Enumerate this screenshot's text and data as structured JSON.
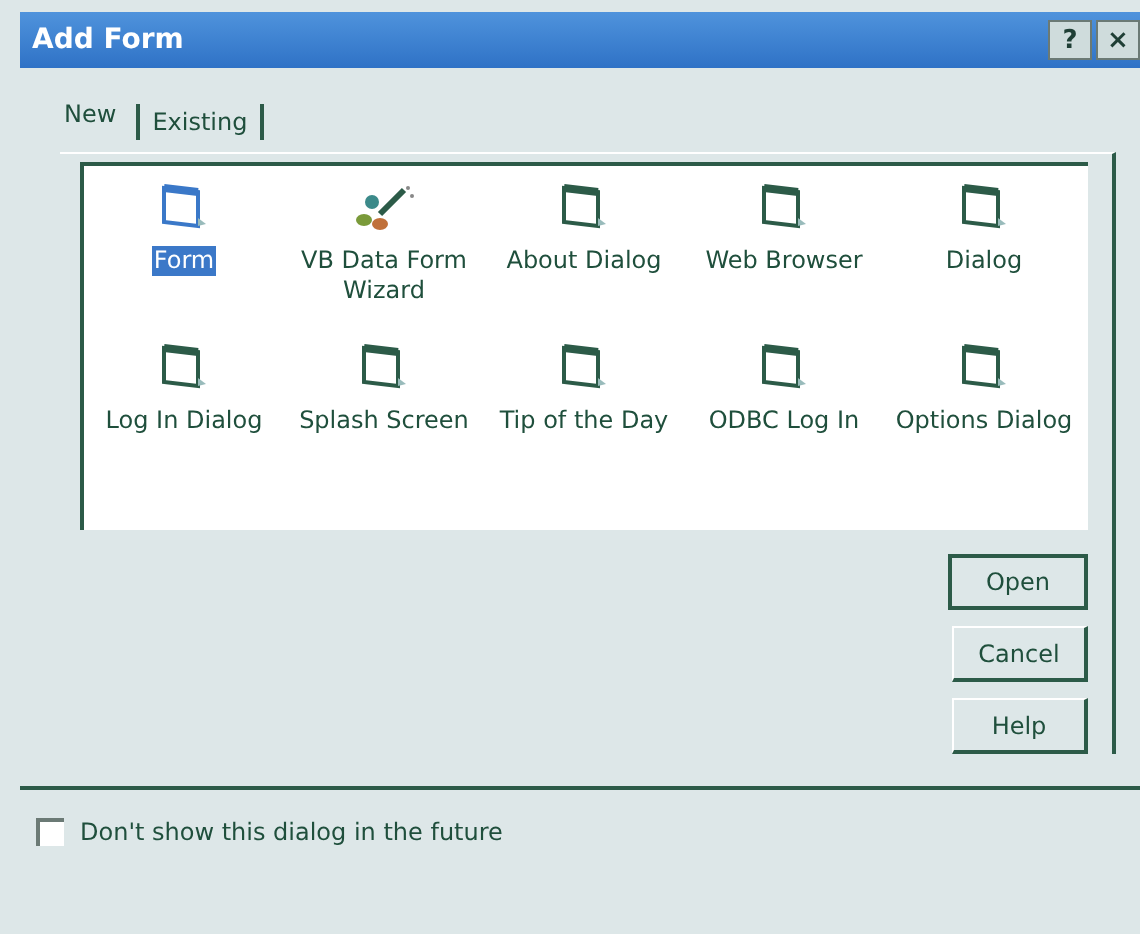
{
  "window": {
    "title": "Add Form",
    "title_buttons": [
      "?",
      "×"
    ]
  },
  "tabs": [
    {
      "label": "New",
      "selected": true
    },
    {
      "label": "Existing",
      "selected": false
    }
  ],
  "templates": [
    {
      "label": "Form",
      "kind": "form",
      "selected": true
    },
    {
      "label": "VB Data Form Wizard",
      "kind": "wizard",
      "selected": false
    },
    {
      "label": "About Dialog",
      "kind": "form",
      "selected": false
    },
    {
      "label": "Web Browser",
      "kind": "form",
      "selected": false
    },
    {
      "label": "Dialog",
      "kind": "form",
      "selected": false
    },
    {
      "label": "Log In Dialog",
      "kind": "form",
      "selected": false
    },
    {
      "label": "Splash Screen",
      "kind": "form",
      "selected": false
    },
    {
      "label": "Tip of the Day",
      "kind": "form",
      "selected": false
    },
    {
      "label": "ODBC Log In",
      "kind": "form",
      "selected": false
    },
    {
      "label": "Options Dialog",
      "kind": "form",
      "selected": false
    }
  ],
  "buttons": [
    {
      "label": "Open",
      "default": true
    },
    {
      "label": "Cancel",
      "default": false
    },
    {
      "label": "Help",
      "default": false
    }
  ],
  "dont_show": {
    "label": "Don't show this dialog in the future",
    "checked": false
  }
}
